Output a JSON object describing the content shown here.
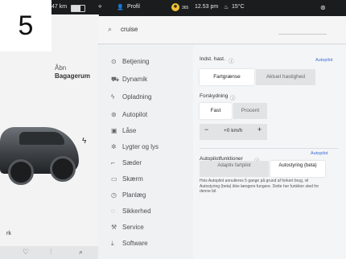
{
  "overlay": {
    "number": "5"
  },
  "status": {
    "range": "47 km",
    "profile": "Profil",
    "fan": "365",
    "time": "12.53 pm",
    "temp": "15°C"
  },
  "car_panel": {
    "open_label": "Åbn",
    "trunk_label": "Bagagerum",
    "partial_text": "rk"
  },
  "search": {
    "query": "cruise"
  },
  "menu": {
    "items": [
      {
        "label": "Betjening",
        "icon": "toggle-icon"
      },
      {
        "label": "Dynamik",
        "icon": "car-icon"
      },
      {
        "label": "Opladning",
        "icon": "bolt-icon"
      },
      {
        "label": "Autopilot",
        "icon": "steering-icon"
      },
      {
        "label": "Låse",
        "icon": "lock-icon"
      },
      {
        "label": "Lygter og lys",
        "icon": "light-icon"
      },
      {
        "label": "Sæder",
        "icon": "seat-icon"
      },
      {
        "label": "Skærm",
        "icon": "screen-icon"
      },
      {
        "label": "Planlæg",
        "icon": "clock-icon"
      },
      {
        "label": "Sikkerhed",
        "icon": "shield-icon"
      },
      {
        "label": "Service",
        "icon": "wrench-icon"
      },
      {
        "label": "Software",
        "icon": "download-icon"
      }
    ]
  },
  "settings": {
    "set_speed_label": "Indst. hast.",
    "set_speed_link": "Autopilot",
    "set_speed_options": [
      "Fartgrænse",
      "Aktuel hastighed"
    ],
    "set_speed_selected": "Fartgrænse",
    "offset_label": "Forskydning",
    "offset_options": [
      "Fast",
      "Procent"
    ],
    "offset_selected": "Fast",
    "offset_value": "+0 km/h",
    "minus": "−",
    "plus": "+",
    "ap_features_label": "Autopilotfunktioner",
    "ap_features_link": "Autopilot",
    "ap_features_options": [
      "Adaptiv fartpilot",
      "Autostyring (beta)"
    ],
    "ap_features_selected": "Autostyring (beta)",
    "description": "Hvis Autopilot annulleres 5 gange på grund af forkert brug, vil Autostyring (beta) ikke længere fungere. Dette her funktion sted for denne bil."
  }
}
